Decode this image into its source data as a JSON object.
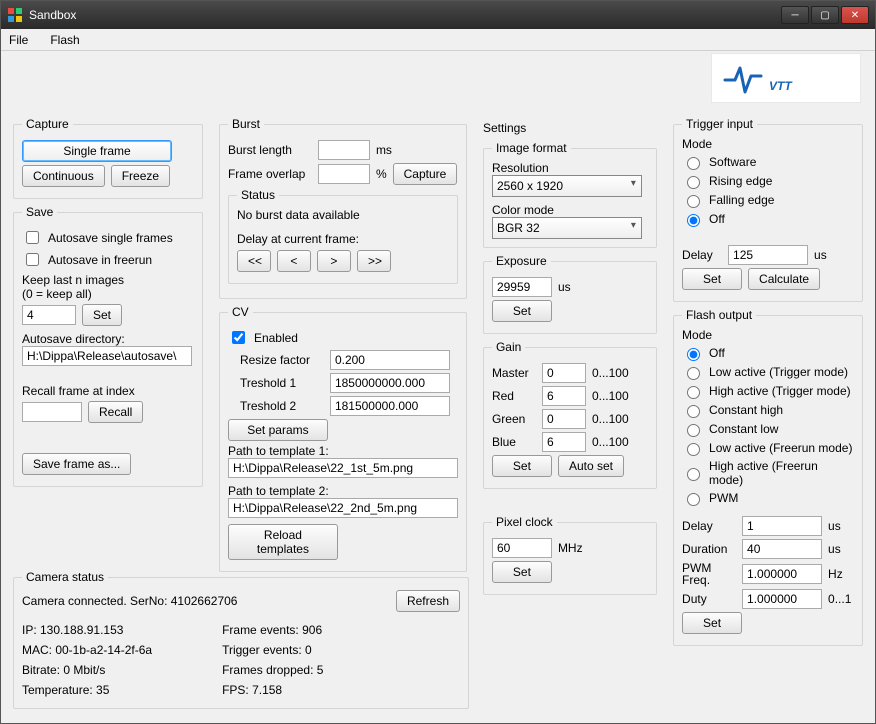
{
  "window": {
    "title": "Sandbox"
  },
  "menu": {
    "file": "File",
    "flash": "Flash"
  },
  "logo_text": "VTT",
  "capture": {
    "legend": "Capture",
    "single_frame": "Single frame",
    "continuous": "Continuous",
    "freeze": "Freeze"
  },
  "save": {
    "legend": "Save",
    "auto_single": "Autosave single frames",
    "auto_freerun": "Autosave in freerun",
    "keep_label": "Keep last n images\n(0 = keep all)",
    "keep_value": "4",
    "set": "Set",
    "dir_label": "Autosave directory:",
    "dir_value": "H:\\Dippa\\Release\\autosave\\",
    "recall_label": "Recall frame at index",
    "recall_value": "",
    "recall_btn": "Recall",
    "save_as": "Save frame as..."
  },
  "burst": {
    "legend": "Burst",
    "len_label": "Burst length",
    "len_unit": "ms",
    "overlap_label": "Frame overlap",
    "overlap_unit": "%",
    "capture": "Capture",
    "status_legend": "Status",
    "status_text": "No burst data available",
    "delay_label": "Delay at current frame:",
    "nav_first": "<<",
    "nav_prev": "<",
    "nav_next": ">",
    "nav_last": ">>"
  },
  "cv": {
    "legend": "CV",
    "enabled": "Enabled",
    "resize_label": "Resize factor",
    "resize_value": "0.200",
    "t1_label": "Treshold 1",
    "t1_value": "1850000000.000",
    "t2_label": "Treshold 2",
    "t2_value": "181500000.000",
    "set_params": "Set params",
    "path1_label": "Path to template 1:",
    "path1_value": "H:\\Dippa\\Release\\22_1st_5m.png",
    "path2_label": "Path to template 2:",
    "path2_value": "H:\\Dippa\\Release\\22_2nd_5m.png",
    "reload": "Reload templates"
  },
  "camstatus": {
    "legend": "Camera status",
    "connected": "Camera connected. SerNo: 4102662706",
    "refresh": "Refresh",
    "ip": "IP: 130.188.91.153",
    "mac": "MAC: 00-1b-a2-14-2f-6a",
    "bitrate": "Bitrate: 0 Mbit/s",
    "temp": "Temperature: 35",
    "frame_events": "Frame events: 906",
    "trigger_events": "Trigger events: 0",
    "frames_dropped": "Frames dropped: 5",
    "fps": "FPS: 7.158"
  },
  "settings": {
    "legend": "Settings",
    "imgfmt_legend": "Image format",
    "res_label": "Resolution",
    "res_value": "2560 x 1920",
    "color_label": "Color mode",
    "color_value": "BGR 32",
    "exposure_legend": "Exposure",
    "exposure_value": "29959",
    "exposure_unit": "us",
    "set": "Set",
    "gain_legend": "Gain",
    "master_label": "Master",
    "master_value": "0",
    "red_label": "Red",
    "red_value": "6",
    "green_label": "Green",
    "green_value": "0",
    "blue_label": "Blue",
    "blue_value": "6",
    "range": "0...100",
    "auto_set": "Auto set",
    "pixelclock_legend": "Pixel clock",
    "pixelclock_value": "60",
    "pixelclock_unit": "MHz"
  },
  "trigger": {
    "legend": "Trigger input",
    "mode_label": "Mode",
    "software": "Software",
    "rising": "Rising edge",
    "falling": "Falling edge",
    "off": "Off",
    "delay_label": "Delay",
    "delay_value": "125",
    "delay_unit": "us",
    "set": "Set",
    "calculate": "Calculate"
  },
  "flashout": {
    "legend": "Flash output",
    "mode_label": "Mode",
    "off": "Off",
    "low_trig": "Low active (Trigger mode)",
    "high_trig": "High active (Trigger mode)",
    "const_high": "Constant high",
    "const_low": "Constant low",
    "low_free": "Low active (Freerun mode)",
    "high_free": "High active (Freerun mode)",
    "pwm": "PWM",
    "delay_label": "Delay",
    "delay_value": "1",
    "delay_unit": "us",
    "duration_label": "Duration",
    "duration_value": "40",
    "duration_unit": "us",
    "pwmfreq_label": "PWM\nFreq.",
    "pwmfreq_value": "1.000000",
    "pwmfreq_unit": "Hz",
    "duty_label": "Duty",
    "duty_value": "1.000000",
    "duty_unit": "0...1",
    "set": "Set"
  }
}
